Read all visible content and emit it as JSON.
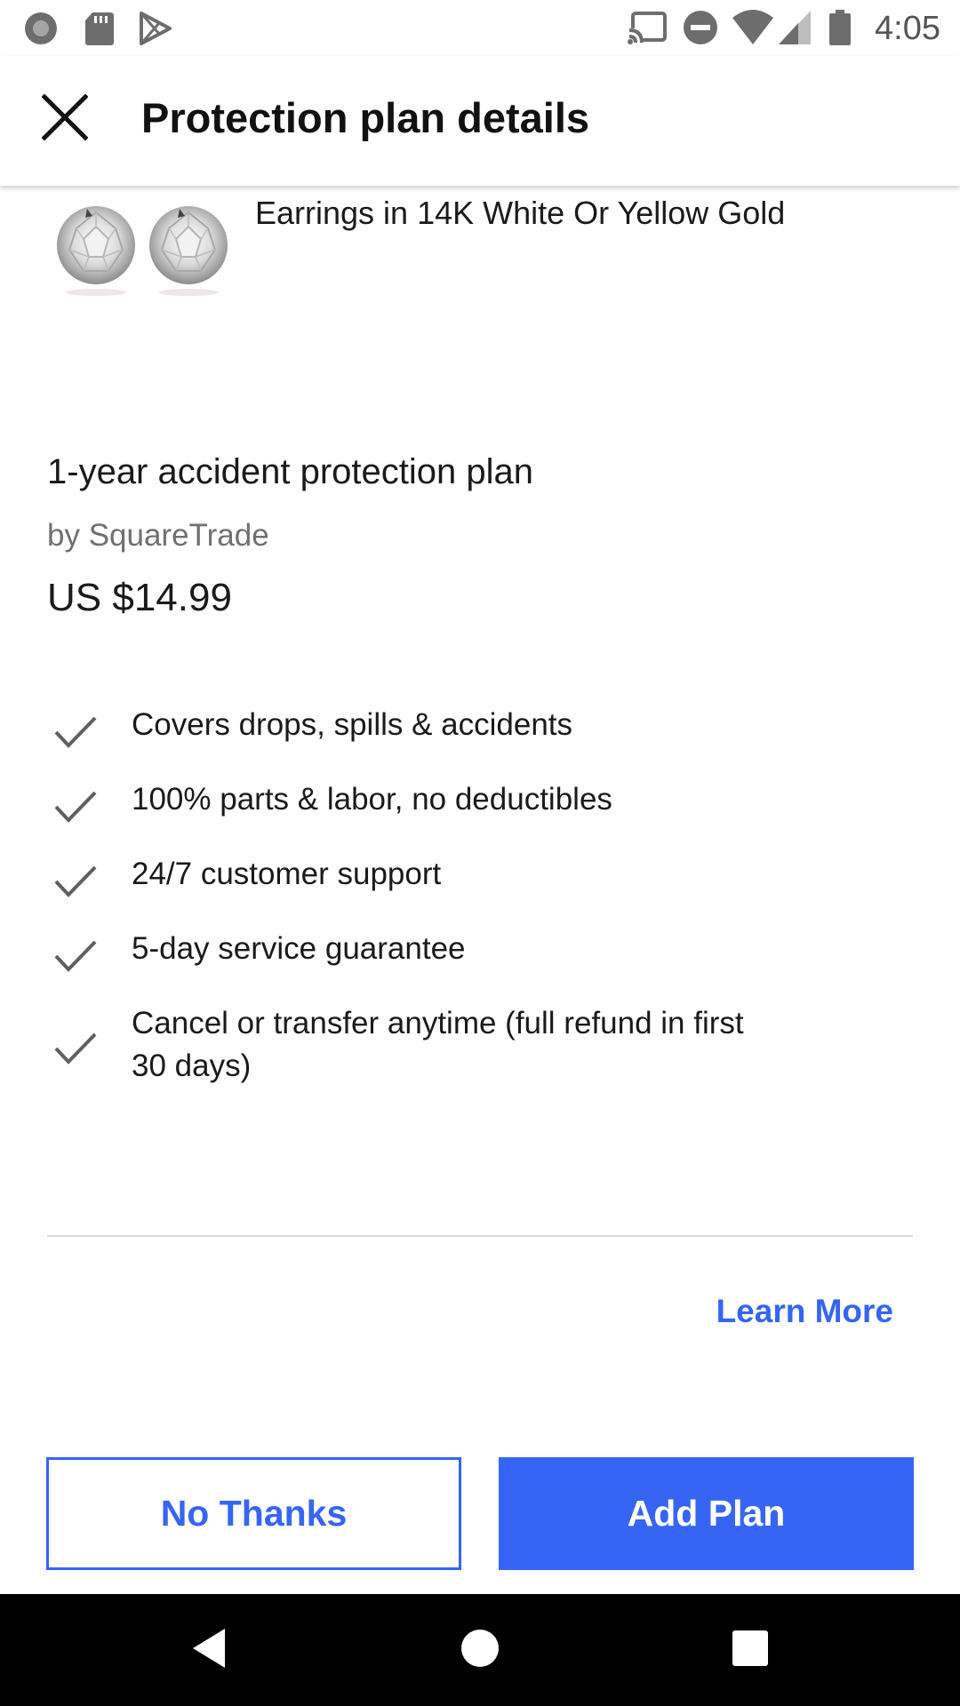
{
  "status_bar": {
    "time": "4:05",
    "left_icons": [
      "circle-notification-icon",
      "sd-card-icon",
      "play-store-icon"
    ],
    "right_icons": [
      "cast-icon",
      "do-not-disturb-icon",
      "wifi-icon",
      "cell-signal-icon",
      "battery-icon"
    ]
  },
  "app_bar": {
    "title": "Protection plan details",
    "close_icon": "close-icon"
  },
  "item": {
    "title": "Earrings in 14K White Or Yellow Gold",
    "thumbnail_icon": "diamond-earrings-image"
  },
  "plan": {
    "name": "1-year accident protection plan",
    "provider": "by SquareTrade",
    "price": "US $14.99"
  },
  "features": [
    {
      "text": "Covers drops, spills & accidents"
    },
    {
      "text": "100% parts & labor, no deductibles"
    },
    {
      "text": "24/7 customer support"
    },
    {
      "text": "5-day service guarantee"
    },
    {
      "text": "Cancel or transfer anytime (full refund in first 30 days)"
    }
  ],
  "learn_more_label": "Learn More",
  "buttons": {
    "no_thanks": "No Thanks",
    "add_plan": "Add Plan"
  },
  "colors": {
    "accent": "#3665f3",
    "text_primary": "#1a1a1a",
    "text_secondary": "#707070",
    "divider": "#dcdcdc"
  },
  "nav_bar": {
    "icons": [
      "back-icon",
      "home-icon",
      "recents-icon"
    ]
  }
}
